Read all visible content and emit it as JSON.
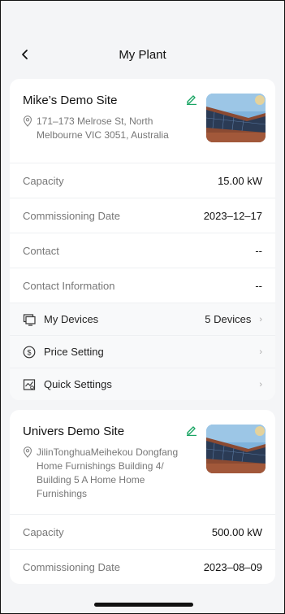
{
  "header": {
    "title": "My Plant"
  },
  "sites": [
    {
      "name": "Mike’s Demo Site",
      "address": "171–173 Melrose St, North Melbourne VIC 3051, Australia",
      "capacity_label": "Capacity",
      "capacity_value": "15.00 kW",
      "commissioning_label": "Commissioning Date",
      "commissioning_value": "2023–12–17",
      "contact_label": "Contact",
      "contact_value": "--",
      "contact_info_label": "Contact Information",
      "contact_info_value": "--",
      "menu": {
        "devices_label": "My Devices",
        "devices_value": "5 Devices",
        "price_label": "Price Setting",
        "quick_label": "Quick Settings"
      }
    },
    {
      "name": "Univers Demo Site",
      "address": "JilinTonghuaMeihekou Dongfang Home Furnishings Building 4/ Building 5 A Home Home Furnishings",
      "capacity_label": "Capacity",
      "capacity_value": "500.00 kW",
      "commissioning_label": "Commissioning Date",
      "commissioning_value": "2023–08–09"
    }
  ],
  "colors": {
    "accent": "#1aa564",
    "text": "#111111",
    "muted": "#777777",
    "background": "#f4f5f7"
  },
  "icons": {
    "back": "chevron-left-icon",
    "edit": "pencil-icon",
    "location": "location-pin-icon",
    "devices": "monitor-icon",
    "price": "dollar-circle-icon",
    "quick": "chart-settings-icon"
  }
}
